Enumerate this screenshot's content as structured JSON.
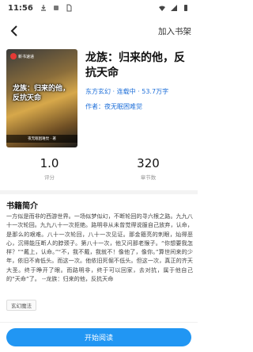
{
  "status_bar": {
    "time": "11:56"
  },
  "header": {
    "add_shelf_label": "加入书架"
  },
  "book": {
    "cover_badge": "新书速递",
    "cover_title": "龙族：归来的他，反抗天命",
    "cover_footer": "夜无眠困难觉 · 著",
    "title": "龙族：归来的他，反抗天命",
    "meta": "东方玄幻 · 连载中 · 53.7万字",
    "author_label": "作者：",
    "author": "夜无眠困难觉"
  },
  "stats": [
    {
      "value": "1.0",
      "label": "评分"
    },
    {
      "value": "320",
      "label": "章节数"
    }
  ],
  "synopsis": {
    "title": "书籍简介",
    "text": "一方似是而非的西游世界。一场似梦似幻，不断轮回的寻六根之路。九九八十一次轮回。九九八十一次拒绝。路明非从未曾觉得说服自己放弃，认命，是那么的艰难。八十一次轮回，八十一次见证。那金箍亮的刺眼，灿得恶心，沉得能压断人的脖颈子。第八十一次，他又问那老猴子。“你想要我怎样？”“戴上，认命。”“不，我不戴，我就不！像他了，像你。”算世间来的少年，依旧不肯低头。而这一次。他依旧死倔不低头。但这一次，真正的齐天大圣。终于睁开了眼。而路明非，终于可以回家，去对抗，属于他自己的“天命”了。 --龙族：归来的他，反抗天命",
    "tag": "玄幻魔法"
  },
  "actions": {
    "read_label": "开始阅读"
  },
  "colors": {
    "accent": "#2196f3",
    "link": "#1e6fd9"
  }
}
